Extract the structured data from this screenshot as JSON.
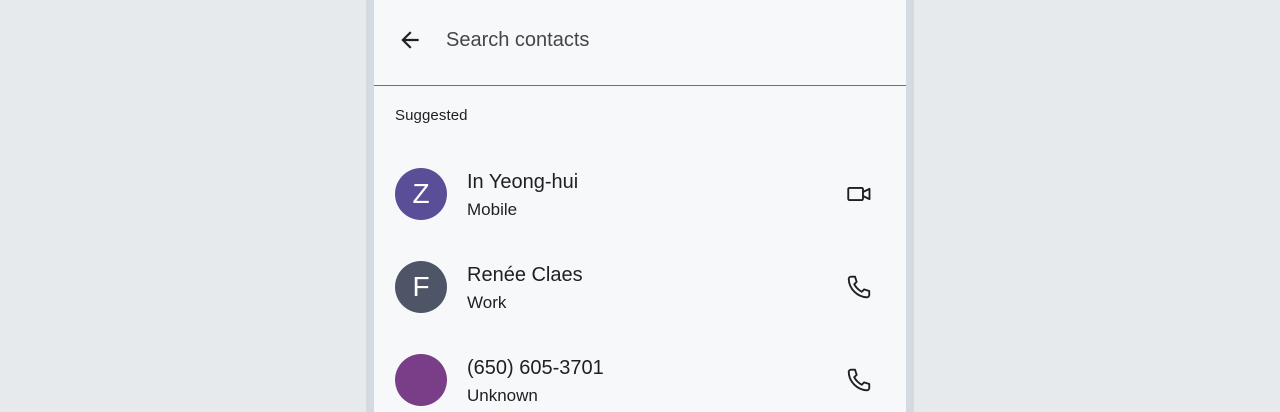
{
  "search": {
    "placeholder": "Search contacts",
    "value": ""
  },
  "section": {
    "title": "Suggested"
  },
  "contacts": [
    {
      "initial": "Z",
      "name": "In Yeong-hui",
      "type": "Mobile",
      "avatar_color": "#5a4e98",
      "action_icon": "video-camera-icon"
    },
    {
      "initial": "F",
      "name": "Renée Claes",
      "type": "Work",
      "avatar_color": "#4e5566",
      "action_icon": "phone-icon"
    },
    {
      "initial": "",
      "name": "(650) 605-3701",
      "type": "Unknown",
      "avatar_color": "#7a3d87",
      "action_icon": "phone-icon"
    }
  ]
}
